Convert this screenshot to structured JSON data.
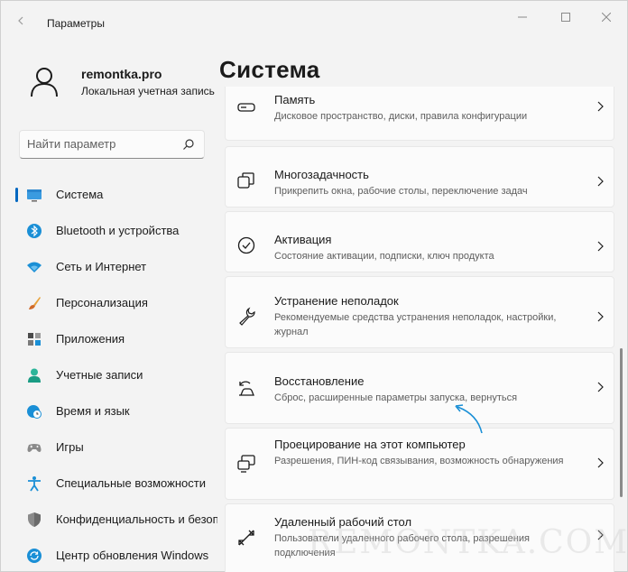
{
  "window": {
    "title": "Параметры"
  },
  "user": {
    "name": "remontka.pro",
    "account_type": "Локальная учетная запись"
  },
  "search": {
    "placeholder": "Найти параметр"
  },
  "sidebar": {
    "items": [
      {
        "label": "Система",
        "icon": "monitor-icon",
        "active": true
      },
      {
        "label": "Bluetooth и устройства",
        "icon": "bluetooth-icon"
      },
      {
        "label": "Сеть и Интернет",
        "icon": "wifi-icon"
      },
      {
        "label": "Персонализация",
        "icon": "brush-icon"
      },
      {
        "label": "Приложения",
        "icon": "apps-icon"
      },
      {
        "label": "Учетные записи",
        "icon": "person-icon"
      },
      {
        "label": "Время и язык",
        "icon": "globe-clock-icon"
      },
      {
        "label": "Игры",
        "icon": "gamepad-icon"
      },
      {
        "label": "Специальные возможности",
        "icon": "accessibility-icon"
      },
      {
        "label": "Конфиденциальность и безопасность",
        "icon": "shield-icon"
      },
      {
        "label": "Центр обновления Windows",
        "icon": "update-icon"
      }
    ]
  },
  "main": {
    "title": "Система",
    "cards": [
      {
        "title": "Память",
        "subtitle": "Дисковое пространство, диски, правила конфигурации",
        "icon": "storage-icon"
      },
      {
        "title": "Многозадачность",
        "subtitle": "Прикрепить окна, рабочие столы, переключение задач",
        "icon": "multitasking-icon"
      },
      {
        "title": "Активация",
        "subtitle": "Состояние активации, подписки, ключ продукта",
        "icon": "activation-check-icon"
      },
      {
        "title": "Устранение неполадок",
        "subtitle": "Рекомендуемые средства устранения неполадок, настройки, журнал",
        "icon": "wrench-icon"
      },
      {
        "title": "Восстановление",
        "subtitle": "Сброс, расширенные параметры запуска, вернуться",
        "icon": "recovery-icon"
      },
      {
        "title": "Проецирование на этот компьютер",
        "subtitle": "Разрешения, ПИН-код связывания, возможность обнаружения",
        "icon": "projection-icon"
      },
      {
        "title": "Удаленный рабочий стол",
        "subtitle": "Пользователи удаленного рабочего стола, разрешения подключения",
        "icon": "remote-desktop-icon"
      }
    ]
  },
  "watermark": "REMONTKA.COM",
  "colors": {
    "accent": "#0067c0",
    "background": "#f3f3f3",
    "card": "#fbfbfb",
    "annotation_arrow": "#1a8fd6"
  }
}
